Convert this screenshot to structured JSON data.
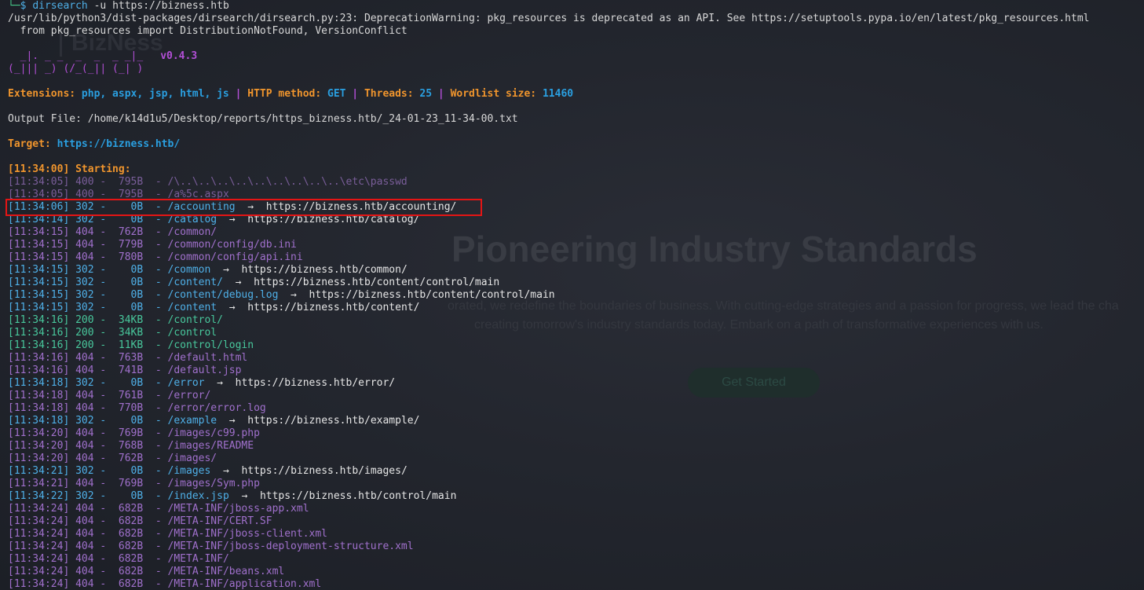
{
  "colors": {
    "terminal_bg": "#1e2129",
    "header_orange": "#f0952d",
    "value_blue": "#2a9fe0",
    "banner_purple": "#b24fd6",
    "status_404": "#a070cc",
    "status_302": "#4fb0e8",
    "status_200": "#48c79c",
    "highlight_red": "#e41515"
  },
  "background_site": {
    "logo": "BizNess",
    "headline": "Pioneering Industry Standards",
    "subtext_1": "orated, we redefine the boundaries of business. With cutting-edge strategies and a passion for progress, we lead the cha",
    "subtext_2": "creating tomorrow's industry standards today. Embark on a path of transformative experiences with us.",
    "button": "Get Started"
  },
  "prompt": {
    "corner": "└─",
    "symbol": "$",
    "command": "dirsearch",
    "args": " -u https://bizness.htb"
  },
  "warning": {
    "line1": "/usr/lib/python3/dist-packages/dirsearch/dirsearch.py:23: DeprecationWarning: pkg_resources is deprecated as an API. See https://setuptools.pypa.io/en/latest/pkg_resources.html",
    "line2": "  from pkg_resources import DistributionNotFound, VersionConflict"
  },
  "banner": {
    "art1": "  _|. _ _  _  _  _ _|_",
    "art2": "(_||| _) (/_(_|| (_| )",
    "version": "v0.4.3"
  },
  "config": {
    "extensions_label": "Extensions: ",
    "extensions_value": "php, aspx, jsp, html, js",
    "sep": " | ",
    "method_label": "HTTP method: ",
    "method_value": "GET",
    "threads_label": "Threads: ",
    "threads_value": "25",
    "wordlist_label": "Wordlist size: ",
    "wordlist_value": "11460"
  },
  "output_file": "Output File: /home/k14d1u5/Desktop/reports/https_bizness.htb/_24-01-23_11-34-00.txt",
  "target": {
    "label": "Target: ",
    "url": "https://bizness.htb/"
  },
  "starting": "[11:34:00] Starting:",
  "results": [
    {
      "ts": "[11:34:05]",
      "status": "400",
      "size": "795B",
      "path": "/\\..\\..\\..\\..\\..\\..\\..\\..\\..\\etc\\passwd",
      "redirect": ""
    },
    {
      "ts": "[11:34:05]",
      "status": "400",
      "size": "795B",
      "path": "/a%5c.aspx",
      "redirect": ""
    },
    {
      "ts": "[11:34:06]",
      "status": "302",
      "size": "0B",
      "path": "/accounting",
      "redirect": "https://bizness.htb/accounting/"
    },
    {
      "ts": "[11:34:14]",
      "status": "302",
      "size": "0B",
      "path": "/catalog",
      "redirect": "https://bizness.htb/catalog/"
    },
    {
      "ts": "[11:34:15]",
      "status": "404",
      "size": "762B",
      "path": "/common/",
      "redirect": ""
    },
    {
      "ts": "[11:34:15]",
      "status": "404",
      "size": "779B",
      "path": "/common/config/db.ini",
      "redirect": ""
    },
    {
      "ts": "[11:34:15]",
      "status": "404",
      "size": "780B",
      "path": "/common/config/api.ini",
      "redirect": ""
    },
    {
      "ts": "[11:34:15]",
      "status": "302",
      "size": "0B",
      "path": "/common",
      "redirect": "https://bizness.htb/common/"
    },
    {
      "ts": "[11:34:15]",
      "status": "302",
      "size": "0B",
      "path": "/content/",
      "redirect": "https://bizness.htb/content/control/main"
    },
    {
      "ts": "[11:34:15]",
      "status": "302",
      "size": "0B",
      "path": "/content/debug.log",
      "redirect": "https://bizness.htb/content/control/main"
    },
    {
      "ts": "[11:34:15]",
      "status": "302",
      "size": "0B",
      "path": "/content",
      "redirect": "https://bizness.htb/content/"
    },
    {
      "ts": "[11:34:16]",
      "status": "200",
      "size": "34KB",
      "path": "/control/",
      "redirect": ""
    },
    {
      "ts": "[11:34:16]",
      "status": "200",
      "size": "34KB",
      "path": "/control",
      "redirect": ""
    },
    {
      "ts": "[11:34:16]",
      "status": "200",
      "size": "11KB",
      "path": "/control/login",
      "redirect": ""
    },
    {
      "ts": "[11:34:16]",
      "status": "404",
      "size": "763B",
      "path": "/default.html",
      "redirect": ""
    },
    {
      "ts": "[11:34:16]",
      "status": "404",
      "size": "741B",
      "path": "/default.jsp",
      "redirect": ""
    },
    {
      "ts": "[11:34:18]",
      "status": "302",
      "size": "0B",
      "path": "/error",
      "redirect": "https://bizness.htb/error/"
    },
    {
      "ts": "[11:34:18]",
      "status": "404",
      "size": "761B",
      "path": "/error/",
      "redirect": ""
    },
    {
      "ts": "[11:34:18]",
      "status": "404",
      "size": "770B",
      "path": "/error/error.log",
      "redirect": ""
    },
    {
      "ts": "[11:34:18]",
      "status": "302",
      "size": "0B",
      "path": "/example",
      "redirect": "https://bizness.htb/example/"
    },
    {
      "ts": "[11:34:20]",
      "status": "404",
      "size": "769B",
      "path": "/images/c99.php",
      "redirect": ""
    },
    {
      "ts": "[11:34:20]",
      "status": "404",
      "size": "768B",
      "path": "/images/README",
      "redirect": ""
    },
    {
      "ts": "[11:34:20]",
      "status": "404",
      "size": "762B",
      "path": "/images/",
      "redirect": ""
    },
    {
      "ts": "[11:34:21]",
      "status": "302",
      "size": "0B",
      "path": "/images",
      "redirect": "https://bizness.htb/images/"
    },
    {
      "ts": "[11:34:21]",
      "status": "404",
      "size": "769B",
      "path": "/images/Sym.php",
      "redirect": ""
    },
    {
      "ts": "[11:34:22]",
      "status": "302",
      "size": "0B",
      "path": "/index.jsp",
      "redirect": "https://bizness.htb/control/main"
    },
    {
      "ts": "[11:34:24]",
      "status": "404",
      "size": "682B",
      "path": "/META-INF/jboss-app.xml",
      "redirect": ""
    },
    {
      "ts": "[11:34:24]",
      "status": "404",
      "size": "682B",
      "path": "/META-INF/CERT.SF",
      "redirect": ""
    },
    {
      "ts": "[11:34:24]",
      "status": "404",
      "size": "682B",
      "path": "/META-INF/jboss-client.xml",
      "redirect": ""
    },
    {
      "ts": "[11:34:24]",
      "status": "404",
      "size": "682B",
      "path": "/META-INF/jboss-deployment-structure.xml",
      "redirect": ""
    },
    {
      "ts": "[11:34:24]",
      "status": "404",
      "size": "682B",
      "path": "/META-INF/",
      "redirect": ""
    },
    {
      "ts": "[11:34:24]",
      "status": "404",
      "size": "682B",
      "path": "/META-INF/beans.xml",
      "redirect": ""
    },
    {
      "ts": "[11:34:24]",
      "status": "404",
      "size": "682B",
      "path": "/META-INF/application.xml",
      "redirect": ""
    }
  ],
  "highlighted_result_index": 2
}
